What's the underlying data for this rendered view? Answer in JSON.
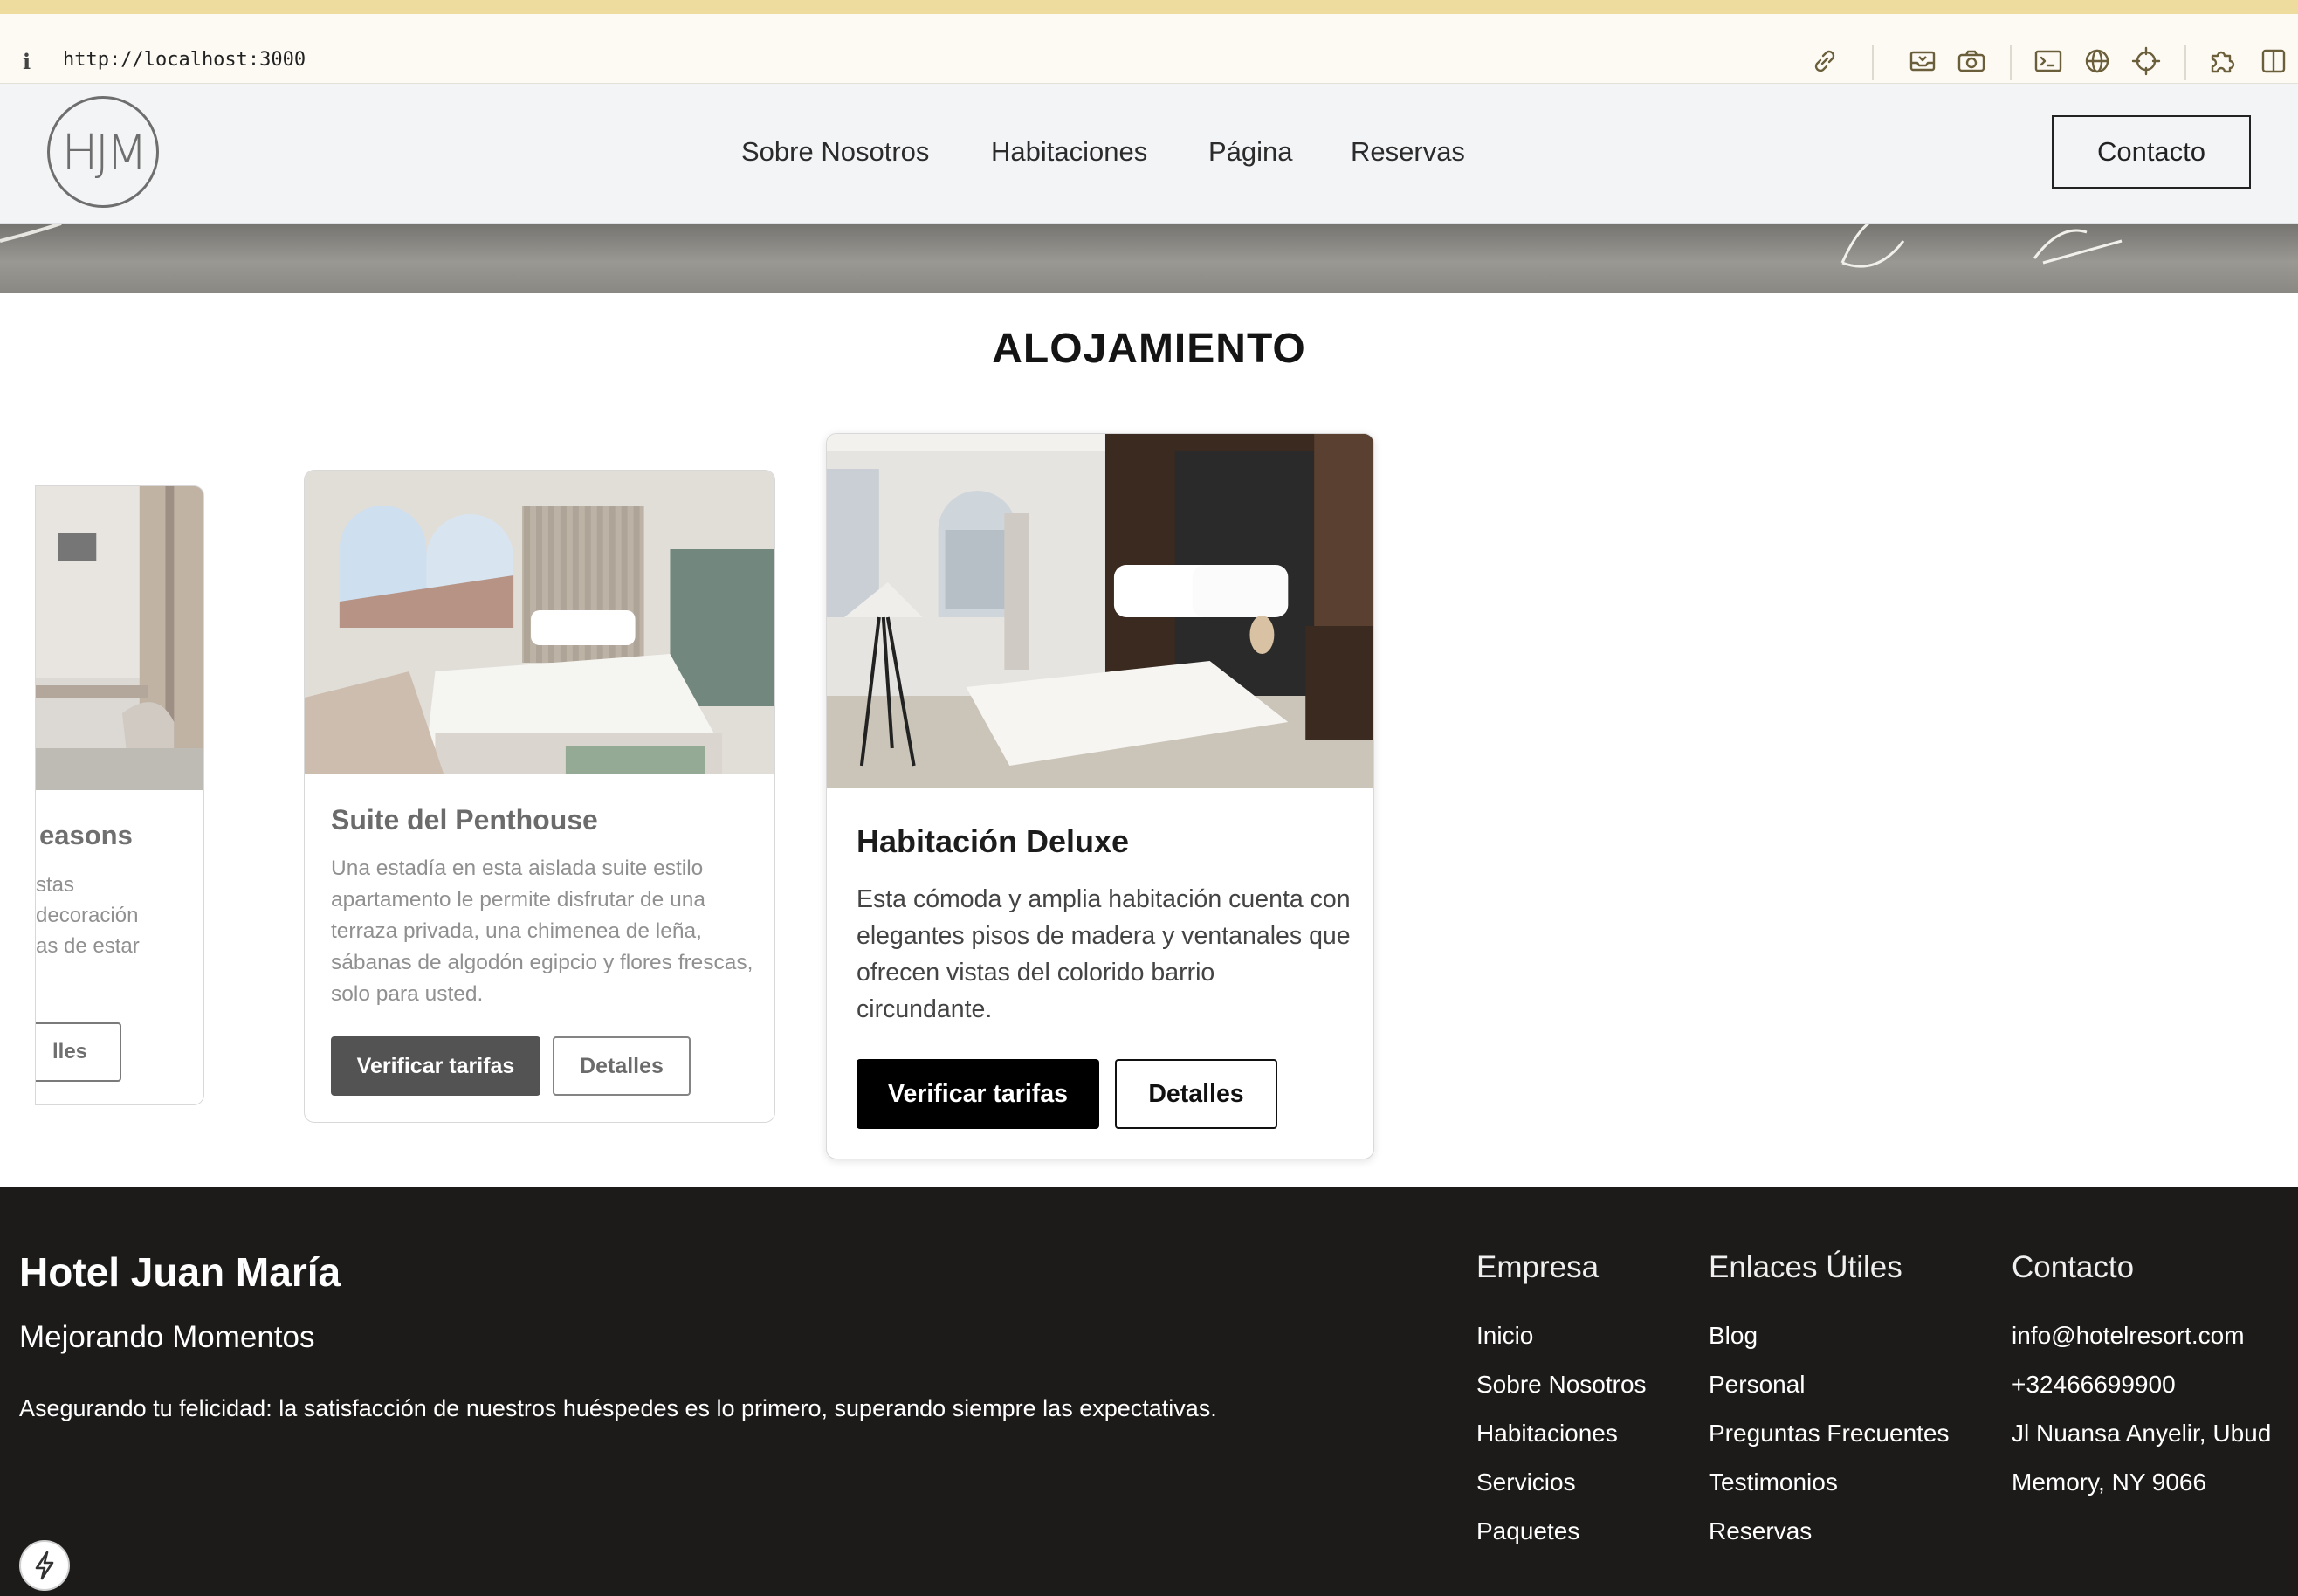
{
  "browser": {
    "url": "http://localhost:3000",
    "info_glyph": "i",
    "toolbar_icons": [
      "link-icon",
      "inbox-icon",
      "camera-icon",
      "terminal-icon",
      "globe-icon",
      "crosshair-icon",
      "puzzle-icon",
      "sidebar-icon"
    ]
  },
  "header": {
    "logo_text": "HJM",
    "nav": [
      "Sobre Nosotros",
      "Habitaciones",
      "Página",
      "Reservas"
    ],
    "contact_label": "Contacto"
  },
  "section": {
    "title": "ALOJAMIENTO"
  },
  "cards": [
    {
      "title_fragment": "easons",
      "desc_lines": [
        "stas",
        "decoración",
        "as de estar"
      ],
      "details_fragment": "lles"
    },
    {
      "title": "Suite del Penthouse",
      "desc": "Una estadía en esta aislada suite estilo apartamento le permite disfrutar de una terraza privada, una chimenea de leña, sábanas de algodón egipcio y flores frescas, solo para usted.",
      "rates_label": "Verificar tarifas",
      "details_label": "Detalles"
    },
    {
      "title": "Habitación Deluxe",
      "desc": "Esta cómoda y amplia habitación cuenta con elegantes pisos de madera y ventanales que ofrecen vistas del colorido barrio circundante.",
      "rates_label": "Verificar tarifas",
      "details_label": "Detalles"
    }
  ],
  "footer": {
    "brand": "Hotel Juan María",
    "tagline": "Mejorando Momentos",
    "mission": "Asegurando tu felicidad: la satisfacción de nuestros huéspedes es lo primero, superando siempre las expectativas.",
    "columns": [
      {
        "heading": "Empresa",
        "links": [
          "Inicio",
          "Sobre Nosotros",
          "Habitaciones",
          "Servicios",
          "Paquetes"
        ]
      },
      {
        "heading": "Enlaces Útiles",
        "links": [
          "Blog",
          "Personal",
          "Preguntas Frecuentes",
          "Testimonios",
          "Reservas"
        ]
      },
      {
        "heading": "Contacto",
        "links": [
          "info@hotelresort.com",
          "+32466699900",
          "Jl Nuansa Anyelir, Ubud",
          "Memory, NY 9066"
        ]
      }
    ]
  },
  "colors": {
    "footer_bg": "#1c1b19",
    "header_bg": "#f3f4f6",
    "primary_button": "#000000",
    "topstrip": "#eddc9e"
  }
}
